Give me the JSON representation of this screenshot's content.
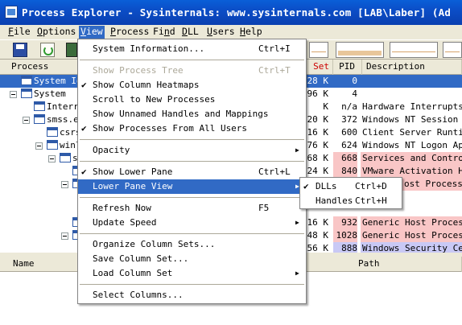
{
  "window": {
    "title": "Process Explorer - Sysinternals: www.sysinternals.com [LAB\\Laber] (Ad"
  },
  "menubar": [
    {
      "label": "File",
      "hot": "F",
      "rest": "ile"
    },
    {
      "label": "Options",
      "hot": "O",
      "rest": "ptions"
    },
    {
      "label": "View",
      "hot": "V",
      "rest": "iew"
    },
    {
      "label": "Process",
      "hot": "P",
      "rest": "rocess"
    },
    {
      "label": "Find",
      "hot": "n",
      "rest": "Fi d"
    },
    {
      "label": "DLL",
      "hot": "D",
      "rest": "LL"
    },
    {
      "label": "Users",
      "hot": "U",
      "rest": "sers"
    },
    {
      "label": "Help",
      "hot": "H",
      "rest": "elp"
    }
  ],
  "columns": {
    "process": "Process",
    "set": "Set",
    "pid": "PID",
    "description": "Description"
  },
  "processes": [
    {
      "name": "System Idl",
      "set": "28 K",
      "pid": "0",
      "description": ""
    },
    {
      "name": "System",
      "set": "96 K",
      "pid": "4",
      "description": ""
    },
    {
      "name": "Interr",
      "set": "K",
      "pid": "n/a",
      "description": "Hardware Interrupts a"
    },
    {
      "name": "smss.ex",
      "set": "20 K",
      "pid": "372",
      "description": "Windows NT Session Ma"
    },
    {
      "name": "csrs",
      "set": "16 K",
      "pid": "600",
      "description": "Client Server Runtime"
    },
    {
      "name": "winl",
      "set": "76 K",
      "pid": "624",
      "description": "Windows NT Logon Appl"
    },
    {
      "name": "s",
      "set": "68 K",
      "pid": "668",
      "description": "Services and Controll"
    },
    {
      "name": "",
      "set": "24 K",
      "pid": "840",
      "description": "VMware Activation Hel"
    },
    {
      "name": "",
      "set": "",
      "pid": "",
      "description": "ost Process"
    },
    {
      "name": "",
      "set": "16 K",
      "pid": "932",
      "description": "Generic Host Process"
    },
    {
      "name": "",
      "set": "48 K",
      "pid": "1028",
      "description": "Generic Host Process"
    },
    {
      "name": "",
      "set": "56 K",
      "pid": "888",
      "description": "Windows Security Cent"
    }
  ],
  "lower_columns": {
    "name": "Name",
    "path": "Path"
  },
  "view_menu": {
    "items": [
      {
        "label": "System Information...",
        "shortcut": "Ctrl+I",
        "checked": false,
        "disabled": false,
        "submenu": false
      },
      {
        "label": "Show Process Tree",
        "shortcut": "Ctrl+T",
        "checked": false,
        "disabled": true,
        "submenu": false
      },
      {
        "label": "Show Column Heatmaps",
        "shortcut": "",
        "checked": true,
        "disabled": false,
        "submenu": false
      },
      {
        "label": "Scroll to New Processes",
        "shortcut": "",
        "checked": false,
        "disabled": false,
        "submenu": false
      },
      {
        "label": "Show Unnamed Handles and Mappings",
        "shortcut": "",
        "checked": false,
        "disabled": false,
        "submenu": false
      },
      {
        "label": "Show Processes From All Users",
        "shortcut": "",
        "checked": true,
        "disabled": false,
        "submenu": false
      },
      {
        "label": "Opacity",
        "shortcut": "",
        "checked": false,
        "disabled": false,
        "submenu": true
      },
      {
        "label": "Show Lower Pane",
        "shortcut": "Ctrl+L",
        "checked": true,
        "disabled": false,
        "submenu": false
      },
      {
        "label": "Lower Pane View",
        "shortcut": "",
        "checked": false,
        "disabled": false,
        "submenu": true,
        "highlighted": true
      },
      {
        "label": "Refresh Now",
        "shortcut": "F5",
        "checked": false,
        "disabled": false,
        "submenu": false
      },
      {
        "label": "Update Speed",
        "shortcut": "",
        "checked": false,
        "disabled": false,
        "submenu": true
      },
      {
        "label": "Organize Column Sets...",
        "shortcut": "",
        "checked": false,
        "disabled": false,
        "submenu": false
      },
      {
        "label": "Save Column Set...",
        "shortcut": "",
        "checked": false,
        "disabled": false,
        "submenu": false
      },
      {
        "label": "Load Column Set",
        "shortcut": "",
        "checked": false,
        "disabled": false,
        "submenu": true
      },
      {
        "label": "Select Columns...",
        "shortcut": "",
        "checked": false,
        "disabled": false,
        "submenu": false
      }
    ]
  },
  "lower_pane_submenu": {
    "items": [
      {
        "label": "DLLs",
        "shortcut": "Ctrl+D",
        "checked": true
      },
      {
        "label": "Handles",
        "shortcut": "Ctrl+H",
        "checked": false
      }
    ]
  },
  "icons": {
    "app": "process-explorer-icon",
    "save": "save-icon",
    "refresh": "refresh-icon",
    "check": "checkmark-icon",
    "submenu": "submenu-arrow-icon"
  },
  "colors": {
    "selection": "#316ac5",
    "title_bar": "#0a4fc8",
    "heat_pink": "#f9c6c6",
    "heat_lavender": "#c9c9f5"
  }
}
